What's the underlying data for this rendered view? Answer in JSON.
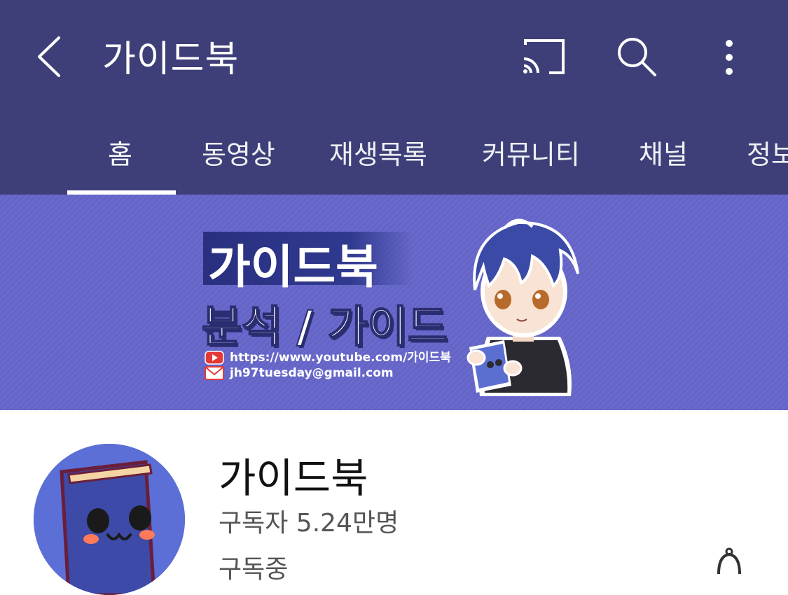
{
  "appbar": {
    "title": "가이드북",
    "icons": [
      "back-arrow-icon",
      "cast-icon",
      "search-icon",
      "more-vert-icon"
    ]
  },
  "tabs": [
    {
      "label": "홈",
      "active": true
    },
    {
      "label": "동영상",
      "active": false
    },
    {
      "label": "재생목록",
      "active": false
    },
    {
      "label": "커뮤니티",
      "active": false
    },
    {
      "label": "채널",
      "active": false
    },
    {
      "label": "정보",
      "active": false
    }
  ],
  "banner": {
    "title": "가이드북",
    "subtitle": "분석 / 가이드",
    "youtube_url": "https://www.youtube.com/가이드북",
    "email": "jh97tuesday@gmail.com"
  },
  "channel": {
    "name": "가이드북",
    "subscribers": "구독자 5.24만명",
    "subscribe_partial": "구독중"
  },
  "colors": {
    "appbar": "#3e3f78",
    "banner": "#6767c9",
    "avatar_bg": "#5b6fd6"
  }
}
